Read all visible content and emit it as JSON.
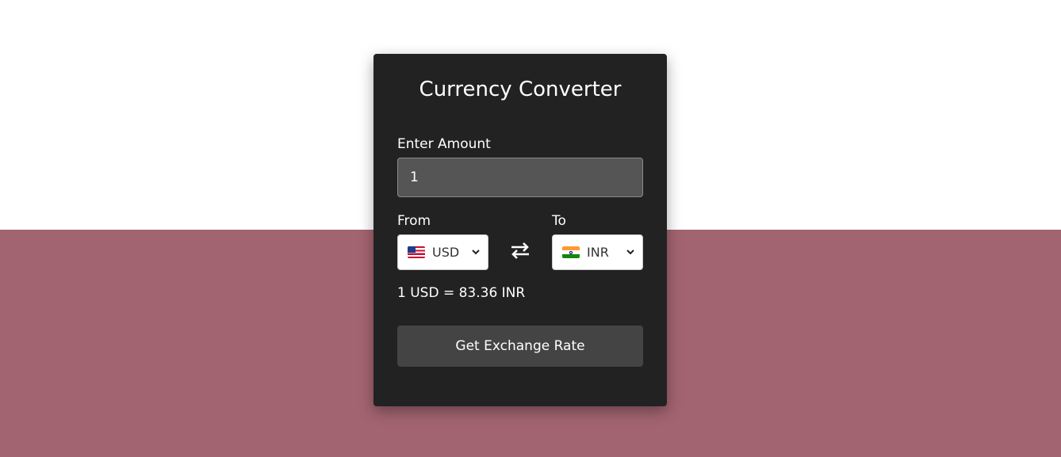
{
  "converter": {
    "title": "Currency Converter",
    "amount_label": "Enter Amount",
    "amount_value": "1",
    "from_label": "From",
    "to_label": "To",
    "from_currency": {
      "code": "USD",
      "flag": "us-flag-icon"
    },
    "to_currency": {
      "code": "INR",
      "flag": "india-flag-icon"
    },
    "swap_icon": "swap-arrows-icon",
    "rate_text": "1 USD = 83.36 INR",
    "button_label": "Get Exchange Rate"
  },
  "colors": {
    "card_bg": "#222222",
    "input_bg": "#555555",
    "button_bg": "#444444",
    "page_bottom": "#a26470",
    "page_top": "#ffffff"
  }
}
